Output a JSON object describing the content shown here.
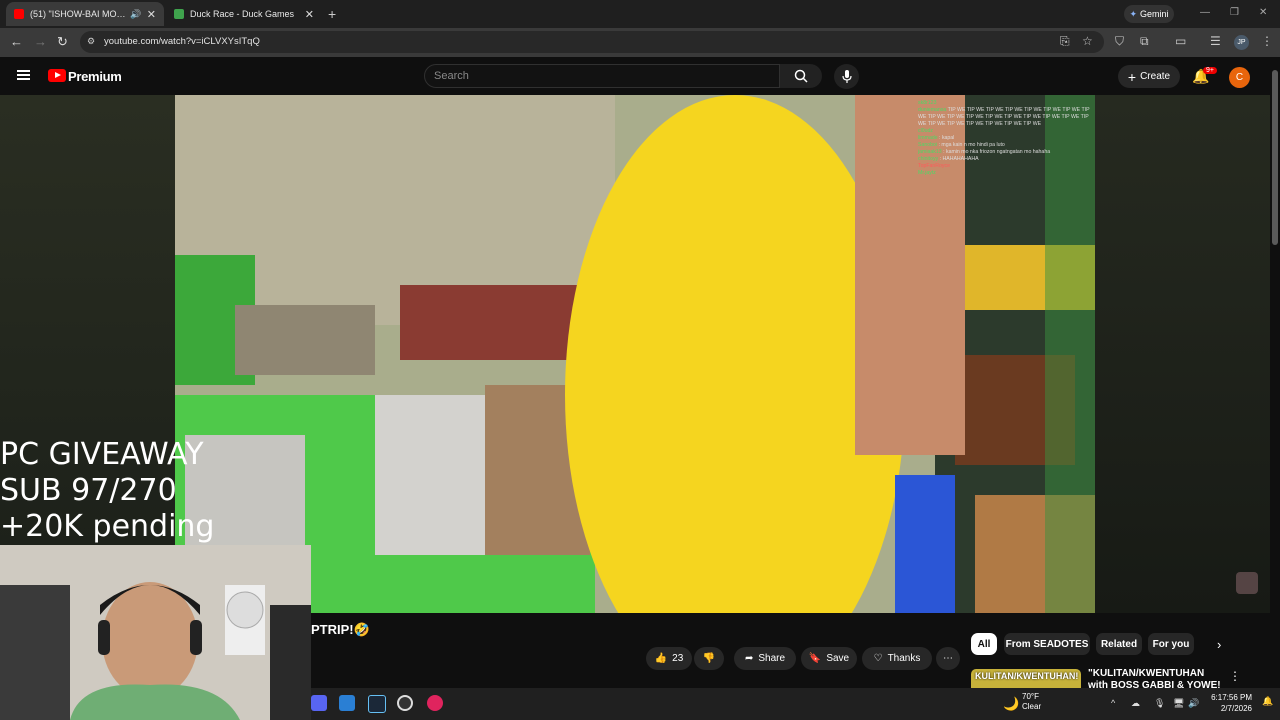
{
  "browser": {
    "tabs": [
      {
        "title": "(51) \"ISHOW-BAI MODE NA",
        "active": true,
        "favicon": "youtube-icon",
        "audio": true
      },
      {
        "title": "Duck Race - Duck Games",
        "active": false,
        "favicon": "duck-icon"
      }
    ],
    "gemini_label": "Gemini",
    "url": "youtube.com/watch?v=iCLVXYsITqQ",
    "profile": "JP"
  },
  "youtube": {
    "logo_text": "Premium",
    "search_placeholder": "Search",
    "create_label": "Create",
    "notifications_badge": "9+",
    "avatar_letter": "C"
  },
  "overlay": {
    "giveaway_lines": [
      "PC GIVEAWAY",
      "SUB 97/270",
      "+20K pending"
    ]
  },
  "chat": [
    {
      "user": "sk8r123",
      "msg": ""
    },
    {
      "user": "duniemansa",
      "msg": "TIP WE TIP WE TIP WE TIP WE TIP WE TIP WE TIP WE TIP WE TIP WE TIP WE TIP WE TIP WE TIP WE TIP WE TIP WE TIP WE TIP WE TIP WE TIP WE TIP WE TIP WE TIP WE TIP WE"
    },
    {
      "user": "cl0udz",
      "msg": ""
    },
    {
      "user": "limmade",
      "msg": "kapal"
    },
    {
      "user": "Sanoboi",
      "msg": "mga kain n mo hindi pa luto"
    },
    {
      "user": "jamiaak13",
      "msg": "kamin mo nka friozon ngatngatan mo hahaha"
    },
    {
      "user": "chinitoyy",
      "msg": "HAHAHAHAHA"
    },
    {
      "user": "TopFanRoyce",
      "msg": ""
    },
    {
      "user": "Mr.jaytz",
      "msg": ""
    }
  ],
  "video": {
    "title_fragment": "PTRIP!🤣",
    "like_count": "23",
    "share_label": "Share",
    "save_label": "Save",
    "thanks_label": "Thanks",
    "more_label": "⋯"
  },
  "chips": [
    "All",
    "From SEADOTES",
    "Related",
    "For you"
  ],
  "recommendation": {
    "thumb_text": "KULITAN/KWENTUHAN!",
    "title": "\"KULITAN/KWENTUHAN with BOSS GABBI & YOWE! HAHA\""
  },
  "taskbar": {
    "weather_temp": "70°F",
    "weather_cond": "Clear",
    "time": "6:17:56 PM",
    "date": "2/7/2026"
  },
  "colors": {
    "yt_red": "#ff0000",
    "bg": "#0f0f0f",
    "pill": "#272727"
  }
}
